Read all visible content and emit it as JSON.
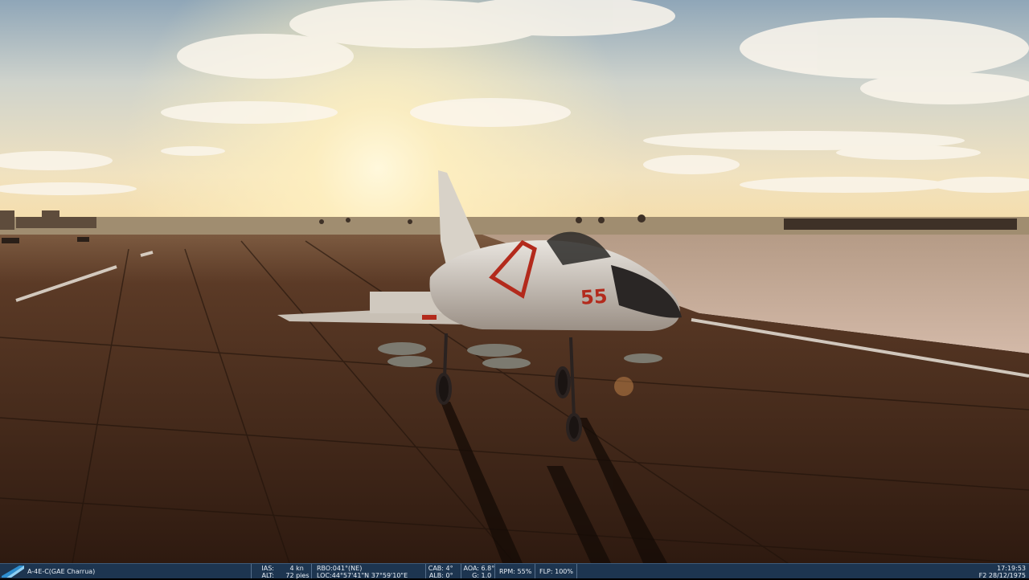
{
  "unit": {
    "name": "A-4E-C(GAE Charrua)"
  },
  "aircraft": {
    "tail_number": "55"
  },
  "telemetry": {
    "ias_label": "IAS:",
    "ias_value": "4",
    "ias_unit": "kn",
    "alt_label": "ALT:",
    "alt_value": "72",
    "alt_unit": "pies",
    "rbo": "RBO:041°(NE)",
    "loc": "LOC:44°57'41\"N 37°59'10\"E",
    "cab_label": "CAB:",
    "cab_value": "4°",
    "alb_label": "ALB:",
    "alb_value": "0°",
    "aoa_label": "AOA:",
    "aoa_value": "6.8°",
    "g_label": "G:",
    "g_value": "1.0",
    "rpm": "RPM: 55%",
    "flp": "FLP: 100%"
  },
  "clock": {
    "time": "17:19:53",
    "date": "F2 28/12/1975"
  },
  "colors": {
    "statusbar_bg": "#1d3550",
    "sky_glow": "#fff1c4",
    "runway": "#4a2c1c"
  }
}
